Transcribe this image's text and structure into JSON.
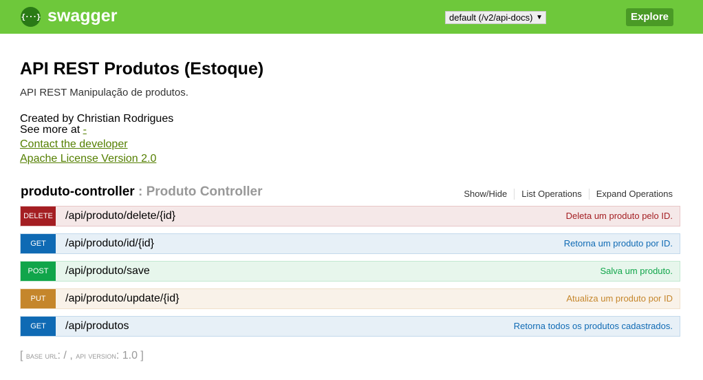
{
  "header": {
    "logo_text": "swagger",
    "logo_icon": "{···}",
    "spec_select": {
      "value": "default (/v2/api-docs)",
      "arrow": "▼"
    },
    "explore_label": "Explore",
    "brand_color": "#6ec83b"
  },
  "info": {
    "title": "API REST Produtos (Estoque)",
    "description": "API REST Manipulação de produtos.",
    "created_by": "Created by Christian Rodrigues",
    "see_more_prefix": "See more at ",
    "see_more_link": "-",
    "contact_link": "Contact the developer",
    "license_link": "Apache License Version 2.0"
  },
  "resource": {
    "name": "produto-controller",
    "separator": " : ",
    "description": "Produto Controller",
    "links": [
      "Show/Hide",
      "List Operations",
      "Expand Operations"
    ]
  },
  "operations": [
    {
      "method": "DELETE",
      "path": "/api/produto/delete/{id}",
      "summary": "Deleta um produto pelo ID."
    },
    {
      "method": "GET",
      "path": "/api/produto/id/{id}",
      "summary": "Retorna um produto por ID."
    },
    {
      "method": "POST",
      "path": "/api/produto/save",
      "summary": "Salva um produto."
    },
    {
      "method": "PUT",
      "path": "/api/produto/update/{id}",
      "summary": "Atualiza um produto por ID"
    },
    {
      "method": "GET",
      "path": "/api/produtos",
      "summary": "Retorna todos os produtos cadastrados."
    }
  ],
  "footer": {
    "open_bracket": "[ ",
    "base_url_label": "base url",
    "base_url_value": ": / , ",
    "api_version_label": "api version",
    "api_version_value": ": 1.0 ",
    "close_bracket": "]"
  }
}
